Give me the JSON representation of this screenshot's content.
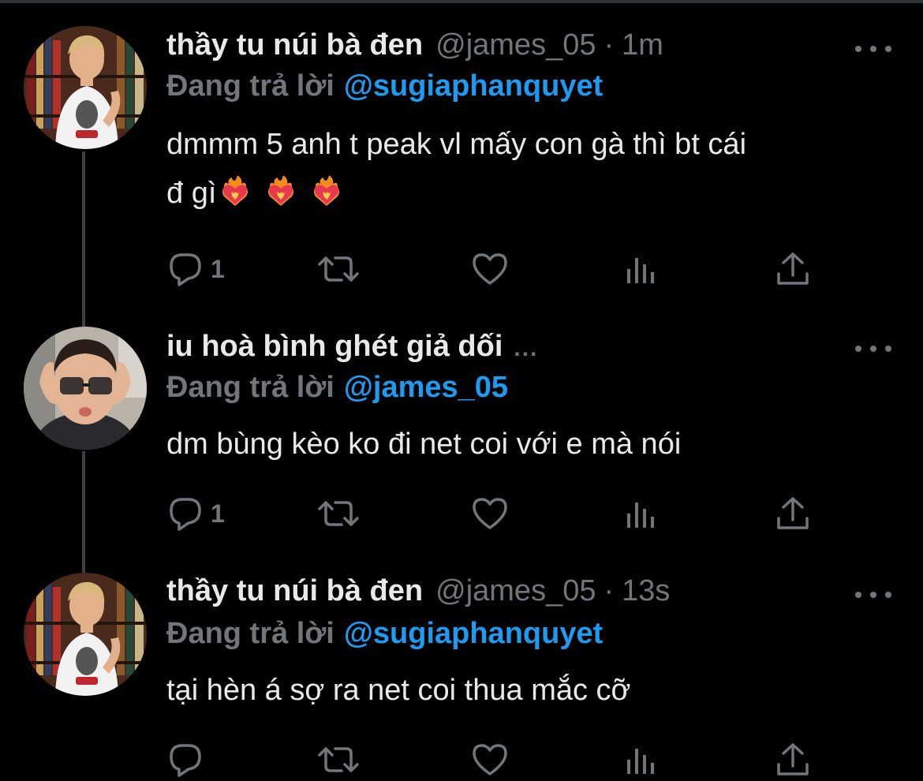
{
  "colors": {
    "background": "#000000",
    "primary_text": "#e7e9ea",
    "secondary_text": "#71767b",
    "mention": "#1d9bf0",
    "thread_line": "#3b3f42"
  },
  "tweets": [
    {
      "display_name": "thầy tu núi bà đen",
      "handle": "@james_05",
      "dot": "·",
      "time": "1m",
      "replying_prefix": "Đang trả lời",
      "replying_to": "@sugiaphanquyet",
      "text_line1": "dmmm 5 anh t peak vl mấy con gà thì bt cái",
      "text_line2": "đ gì",
      "emoji": [
        "heart-on-fire",
        "heart-on-fire",
        "heart-on-fire"
      ],
      "reply_count": "1",
      "icons": [
        "reply-icon",
        "retweet-icon",
        "like-icon",
        "analytics-icon",
        "share-icon"
      ]
    },
    {
      "display_name": "iu hoà bình ghét giả dối",
      "name_ellipsis": "...",
      "replying_prefix": "Đang trả lời",
      "replying_to": "@james_05",
      "text": "dm bùng kèo ko đi net coi với e mà nói",
      "reply_count": "1",
      "icons": [
        "reply-icon",
        "retweet-icon",
        "like-icon",
        "analytics-icon",
        "share-icon"
      ]
    },
    {
      "display_name": "thầy tu núi bà đen",
      "handle": "@james_05",
      "dot": "·",
      "time": "13s",
      "replying_prefix": "Đang trả lời",
      "replying_to": "@sugiaphanquyet",
      "text": "tại hèn á sợ ra net coi thua mắc cỡ",
      "icons": [
        "reply-icon",
        "retweet-icon",
        "like-icon",
        "analytics-icon",
        "share-icon"
      ]
    }
  ]
}
